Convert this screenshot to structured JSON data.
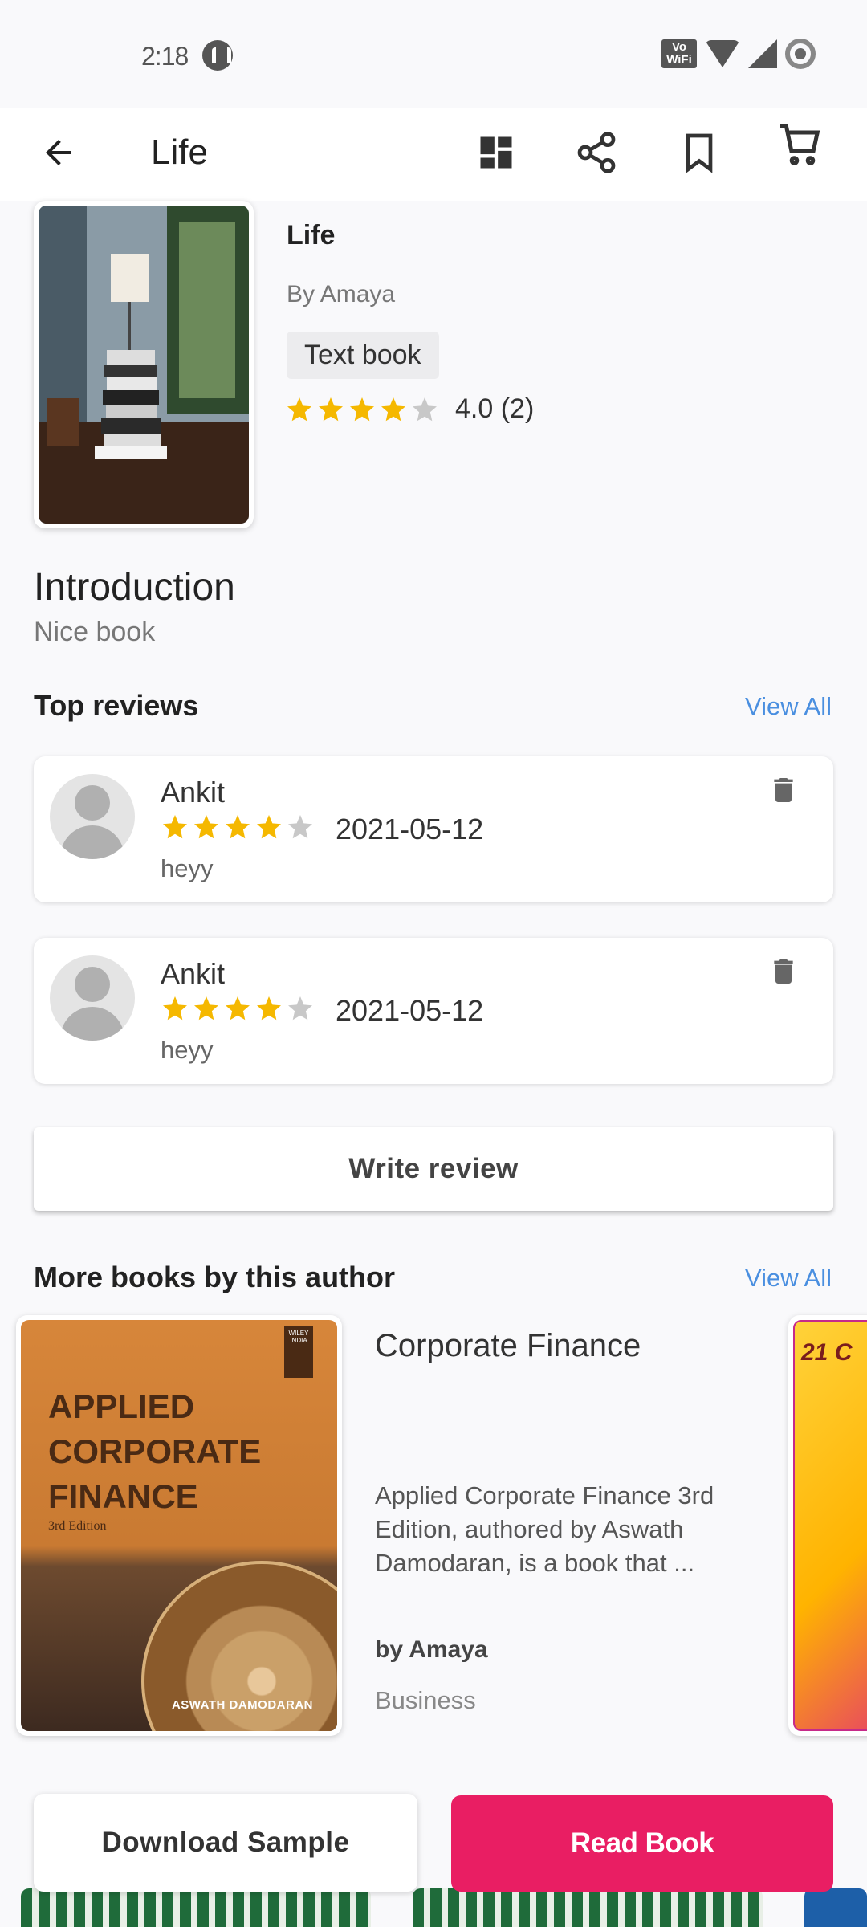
{
  "status_bar": {
    "time": "2:18",
    "network_label": "Vo WiFi"
  },
  "app_bar": {
    "title": "Life"
  },
  "book": {
    "title": "Life",
    "author": "By Amaya",
    "type_chip": "Text book",
    "rating": 4.0,
    "rating_text": "4.0 (2)"
  },
  "introduction": {
    "heading": "Introduction",
    "text": "Nice book"
  },
  "top_reviews": {
    "heading": "Top reviews",
    "view_all": "View All",
    "items": [
      {
        "name": "Ankit",
        "stars": 4,
        "date": "2021-05-12",
        "text": "heyy"
      },
      {
        "name": "Ankit",
        "stars": 4,
        "date": "2021-05-12",
        "text": "heyy"
      }
    ]
  },
  "write_review_label": "Write review",
  "more_books": {
    "heading": "More books by this author",
    "view_all": "View All",
    "items": [
      {
        "title": "Corporate Finance",
        "description": "Applied Corporate Finance 3rd Edition, authored by Aswath Damodaran, is a book that ...",
        "author": "by Amaya",
        "category": "Business",
        "cover": {
          "title_lines": [
            "APPLIED",
            "CORPORATE",
            "FINANCE"
          ],
          "edition": "3rd Edition",
          "author": "ASWATH DAMODARAN",
          "publisher": "WILEY INDIA"
        }
      }
    ],
    "next_cover_text": "21 C"
  },
  "bottom_actions": {
    "download_sample": "Download Sample",
    "read_book": "Read Book"
  },
  "colors": {
    "accent": "#e91e63",
    "link": "#4a8fe0",
    "star_filled": "#f5b800",
    "star_empty": "#c8c8c8"
  },
  "icons": {
    "back": "arrow-left-icon",
    "dashboard": "dashboard-icon",
    "share": "share-icon",
    "bookmark": "bookmark-icon",
    "cart": "cart-icon",
    "trash": "trash-icon"
  }
}
